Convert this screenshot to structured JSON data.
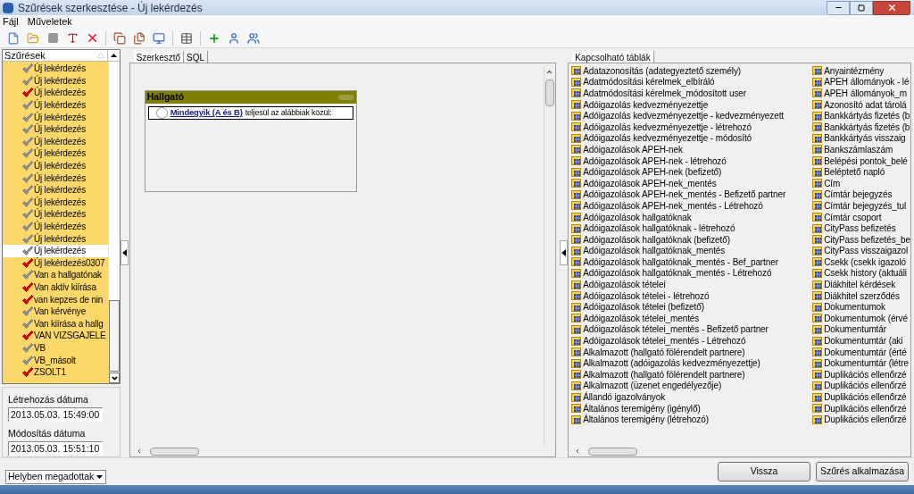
{
  "window": {
    "title": "Szűrések szerkesztése - Új lekérdezés"
  },
  "menu": [
    "Fájl",
    "Műveletek"
  ],
  "filters": {
    "header": "Szűrések",
    "items": [
      {
        "label": "Új lekérdezés",
        "color": "#8c8c8c",
        "selected": false
      },
      {
        "label": "Új lekérdezés",
        "color": "#8c8c8c",
        "selected": false
      },
      {
        "label": "Új lekérdezés",
        "color": "#d40000",
        "selected": false
      },
      {
        "label": "Új lekérdezés",
        "color": "#8c8c8c",
        "selected": false
      },
      {
        "label": "Új lekérdezés",
        "color": "#8c8c8c",
        "selected": false
      },
      {
        "label": "Új lekérdezés",
        "color": "#8c8c8c",
        "selected": false
      },
      {
        "label": "Új lekérdezés",
        "color": "#8c8c8c",
        "selected": false
      },
      {
        "label": "Új lekérdezés",
        "color": "#8c8c8c",
        "selected": false
      },
      {
        "label": "Új lekérdezés",
        "color": "#8c8c8c",
        "selected": false
      },
      {
        "label": "Új lekérdezés",
        "color": "#8c8c8c",
        "selected": false
      },
      {
        "label": "Új lekérdezés",
        "color": "#8c8c8c",
        "selected": false
      },
      {
        "label": "Új lekérdezés",
        "color": "#8c8c8c",
        "selected": false
      },
      {
        "label": "Új lekérdezés",
        "color": "#8c8c8c",
        "selected": false
      },
      {
        "label": "Új lekérdezés",
        "color": "#8c8c8c",
        "selected": false
      },
      {
        "label": "Új lekérdezés",
        "color": "#8c8c8c",
        "selected": false
      },
      {
        "label": "Új lekérdezés",
        "color": "#8c8c8c",
        "selected": true
      },
      {
        "label": "Új lekérdezés0307",
        "color": "#d40000",
        "selected": false
      },
      {
        "label": "Van a hallgatónak",
        "color": "#8c8c8c",
        "selected": false
      },
      {
        "label": "Van aktív kiírása",
        "color": "#d40000",
        "selected": false
      },
      {
        "label": "van kepzes de nin",
        "color": "#d40000",
        "selected": false
      },
      {
        "label": "Van kérvénye",
        "color": "#8c8c8c",
        "selected": false
      },
      {
        "label": "Van kiírása a hallg",
        "color": "#8c8c8c",
        "selected": false
      },
      {
        "label": "VAN VIZSGAJELE",
        "color": "#d40000",
        "selected": false
      },
      {
        "label": "VB",
        "color": "#8c8c8c",
        "selected": false
      },
      {
        "label": "VB_másolt",
        "color": "#8c8c8c",
        "selected": false
      },
      {
        "label": "ZSOLT1",
        "color": "#d40000",
        "selected": false
      }
    ]
  },
  "created": {
    "label": "Létrehozás dátuma",
    "value": "2013.05.03. 15:49:00"
  },
  "modified": {
    "label": "Módosítás dátuma",
    "value": "2013.05.03. 15:51:10"
  },
  "editor_tabs": [
    {
      "label": "Szerkesztő",
      "selected": true
    },
    {
      "label": "SQL",
      "selected": false
    }
  ],
  "entity": {
    "title": "Hallgató",
    "link": "Mindegyik (A és B)",
    "text": "teljesül az alábbiak közül:"
  },
  "tables": {
    "tab": "Kapcsolható táblák",
    "columns": [
      [
        "Adatazonosítás (adategyeztető személy)",
        "Adatmódosítási kérelmek_elbíráló",
        "Adatmódosítási kérelmek_módosított user",
        "Adóigazolás kedvezményezettje",
        "Adóigazolás kedvezményezettje - kedvezményezett",
        "Adóigazolás kedvezményezettje - létrehozó",
        "Adóigazolás kedvezményezettje - módosító",
        "Adóigazolások APEH-nek",
        "Adóigazolások APEH-nek - létrehozó",
        "Adóigazolások APEH-nek (befizető)",
        "Adóigazolások APEH-nek_mentés",
        "Adóigazolások APEH-nek_mentés - Befizető partner",
        "Adóigazolások APEH-nek_mentés - Létrehozó",
        "Adóigazolások hallgatóknak",
        "Adóigazolások hallgatóknak - létrehozó",
        "Adóigazolások hallgatóknak (befizető)",
        "Adóigazolások hallgatóknak_mentés",
        "Adóigazolások hallgatóknak_mentés - Bef_partner",
        "Adóigazolások hallgatóknak_mentés - Létrehozó",
        "Adóigazolások tételei",
        "Adóigazolások tételei - létrehozó",
        "Adóigazolások tételei (befizető)",
        "Adóigazolások tételei_mentés",
        "Adóigazolások tételei_mentés - Befizető partner",
        "Adóigazolások tételei_mentés - Létrehozó",
        "Alkalmazott  (hallgató fölérendelt partnere)",
        "Alkalmazott (adóigazolás kedvezményezettje)",
        "Alkalmazott (hallgató fölérendelt partnere)",
        "Alkalmazott (üzenet engedélyezője)",
        "Állandó igazolványok",
        "Általános teremigény (igénylő)",
        "Általános teremigény (létrehozó)"
      ],
      [
        "Anyaintézmény",
        "APEH állományok - lé",
        "APEH állományok_m",
        "Azonosító adat tárolá",
        "Bankkártyás fizetés (b",
        "Bankkártyás fizetés (b",
        "Bankkártyás visszaig",
        "Bankszámlaszám",
        "Belépési pontok_belé",
        "Beléptető napló",
        "Cím",
        "Címtár bejegyzés",
        "Címtár bejegyzés_tul",
        "Címtár csoport",
        "CityPass befizetés",
        "CityPass befizetés_be",
        "CityPass visszaigazol",
        "Csekk (csekk igazoló",
        "Csekk history (aktuáli",
        "Diákhitel kérdések",
        "Diákhitel szerződés",
        "Dokumentumok",
        "Dokumentumok (érvé",
        "Dokumentumtár",
        "Dokumentumtár (aki",
        "Dokumentumtár (érté",
        "Dokumentumtár (létre",
        "Duplikációs ellenőrzé",
        "Duplikációs ellenőrzé",
        "Duplikációs ellenőrzé",
        "Duplikációs ellenőrzé",
        "Duplikációs ellenőrzé"
      ]
    ]
  },
  "scope": {
    "value": "Helyben megadottak"
  },
  "buttons": [
    "Vissza",
    "Szűrés alkalmazása"
  ]
}
